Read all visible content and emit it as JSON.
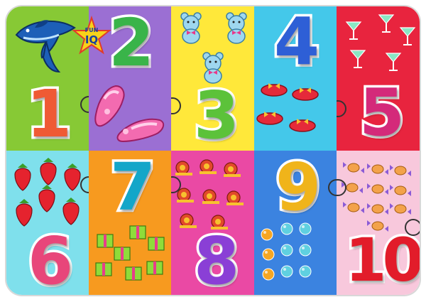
{
  "logo": {
    "word_top": "FUN",
    "word_main": "IQ"
  },
  "tiles": [
    {
      "label": "1",
      "count": 1,
      "object": "dolphin-icon",
      "bg": "#87c935",
      "num_color": "#ef5a34"
    },
    {
      "label": "2",
      "count": 2,
      "object": "ballet-shoe-icon",
      "bg": "#9b6fd3",
      "num_color": "#39b449"
    },
    {
      "label": "3",
      "count": 3,
      "object": "teddy-bear-icon",
      "bg": "#ffe83a",
      "num_color": "#5cc23a"
    },
    {
      "label": "4",
      "count": 4,
      "object": "red-hat-icon",
      "bg": "#44c8ea",
      "num_color": "#2e5fd6"
    },
    {
      "label": "5",
      "count": 5,
      "object": "cocktail-glass-icon",
      "bg": "#e8243e",
      "num_color": "#d42a7a"
    },
    {
      "label": "6",
      "count": 6,
      "object": "strawberry-icon",
      "bg": "#7fe0ec",
      "num_color": "#e8467a"
    },
    {
      "label": "7",
      "count": 7,
      "object": "gift-box-icon",
      "bg": "#f79a1f",
      "num_color": "#13a6c9"
    },
    {
      "label": "8",
      "count": 8,
      "object": "snail-icon",
      "bg": "#ea49a4",
      "num_color": "#8a3fd6"
    },
    {
      "label": "9",
      "count": 9,
      "object": "marble-icon",
      "bg": "#3b83e0",
      "num_color": "#f0b41a"
    },
    {
      "label": "10",
      "count": 10,
      "object": "candy-icon",
      "bg": "#f8c8dc",
      "num_color": "#e21c2a"
    }
  ]
}
